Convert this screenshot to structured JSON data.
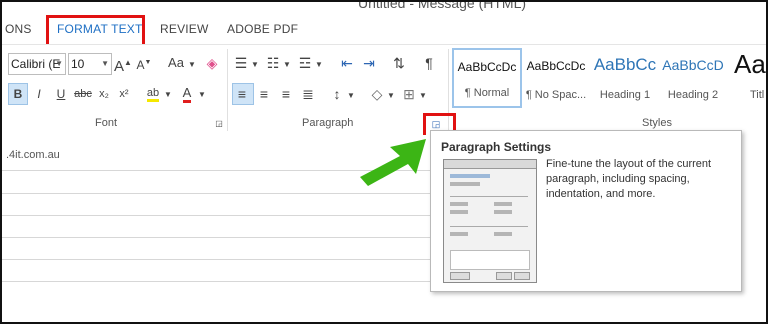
{
  "window": {
    "title": "Untitled - Message (HTML)"
  },
  "tabs": [
    {
      "label": "ONS"
    },
    {
      "label": "FORMAT TEXT"
    },
    {
      "label": "REVIEW"
    },
    {
      "label": "ADOBE PDF"
    }
  ],
  "ribbon": {
    "font": {
      "font_name": "Calibri (E",
      "font_size": "10",
      "group_label": "Font",
      "buttons": {
        "bold": "B",
        "italic": "I",
        "underline": "U",
        "strike": "abc",
        "subscript": "x₂",
        "superscript": "x²",
        "grow": "A",
        "shrink": "A",
        "change_case": "Aa",
        "highlight": "ab",
        "font_color": "A"
      }
    },
    "paragraph": {
      "group_label": "Paragraph",
      "launcher_icon": "dialog-launcher-icon"
    },
    "styles": {
      "group_label": "Styles",
      "items": [
        {
          "preview": "AaBbCcDc",
          "name": "¶ Normal"
        },
        {
          "preview": "AaBbCcDc",
          "name": "¶ No Spac..."
        },
        {
          "preview": "AaBbCc",
          "name": "Heading 1"
        },
        {
          "preview": "AaBbCcD",
          "name": "Heading 2"
        },
        {
          "preview": "Aa",
          "name": "Titl"
        }
      ]
    }
  },
  "document": {
    "visible_text": ".4it.com.au"
  },
  "tooltip": {
    "title": "Paragraph Settings",
    "description": "Fine-tune the layout of the current paragraph, including spacing, indentation, and more."
  },
  "annotation": {
    "arrow_color": "#3cb515",
    "highlight_color": "#e11111"
  }
}
